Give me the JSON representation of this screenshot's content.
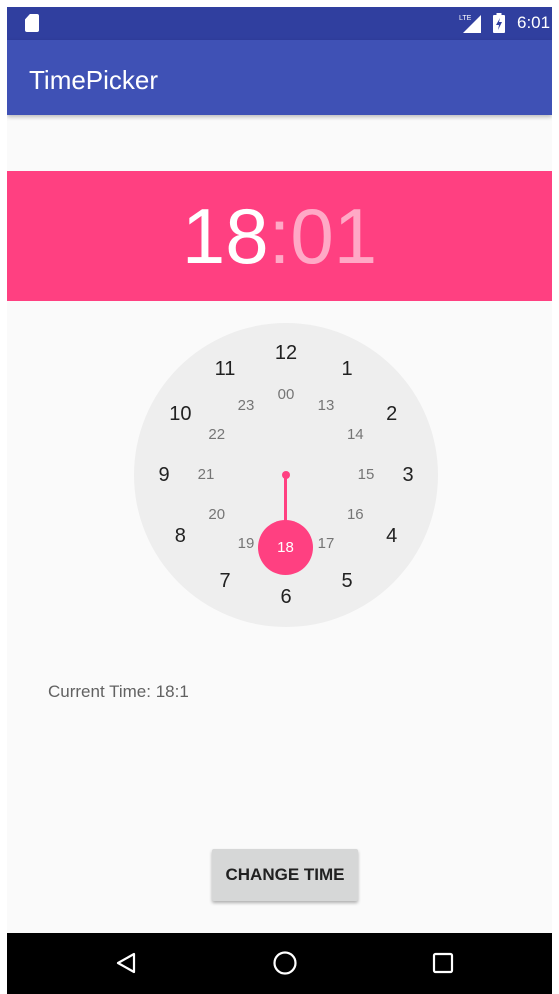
{
  "status_bar": {
    "network": "LTE",
    "time": "6:01"
  },
  "app_bar": {
    "title": "TimePicker"
  },
  "time_picker": {
    "hour": "18",
    "separator": ":",
    "minute": "01",
    "accent_color": "#ff4081",
    "outer_numbers": [
      "12",
      "1",
      "2",
      "3",
      "4",
      "5",
      "6",
      "7",
      "8",
      "9",
      "10",
      "11"
    ],
    "inner_numbers": [
      "00",
      "13",
      "14",
      "15",
      "16",
      "17",
      "18",
      "19",
      "20",
      "21",
      "22",
      "23"
    ],
    "selected_value": "18"
  },
  "current_time_label": "Current Time: 18:1",
  "change_button_label": "CHANGE TIME",
  "colors": {
    "status_bar": "#303f9f",
    "app_bar": "#3f51b5",
    "accent": "#ff4081"
  },
  "nav_bar": {
    "icons": [
      "back-icon",
      "home-icon",
      "recents-icon"
    ]
  }
}
